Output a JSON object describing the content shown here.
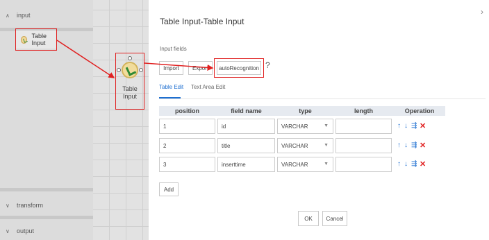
{
  "sidebar": {
    "groups": [
      {
        "label": "input",
        "chevron": "∧"
      },
      {
        "label": "transform",
        "chevron": "∨"
      },
      {
        "label": "output",
        "chevron": "∨"
      }
    ],
    "palette_item": {
      "label": "Table Input",
      "icon": "table-input-icon"
    }
  },
  "canvas": {
    "node": {
      "label_line1": "Table",
      "label_line2": "Input"
    }
  },
  "dialog": {
    "title": "Table Input-Table Input",
    "close_glyph": "›",
    "section_label": "Input fields",
    "buttons": {
      "import": "Import",
      "export": "Export",
      "auto": "autoRecognition",
      "help": "?"
    },
    "tabs": [
      {
        "label": "Table Edit",
        "active": true
      },
      {
        "label": "Text Area Edit",
        "active": false
      }
    ],
    "columns": [
      "position",
      "field name",
      "type",
      "length",
      "Operation"
    ],
    "rows": [
      {
        "position": "1",
        "field_name": "id",
        "type": "VARCHAR",
        "length": ""
      },
      {
        "position": "2",
        "field_name": "title",
        "type": "VARCHAR",
        "length": ""
      },
      {
        "position": "3",
        "field_name": "inserttime",
        "type": "VARCHAR",
        "length": ""
      }
    ],
    "ops": {
      "up": "↑",
      "down": "↓",
      "edit": "⇶",
      "delete": "✕"
    },
    "add": "Add",
    "ok": "OK",
    "cancel": "Cancel"
  },
  "colors": {
    "accent": "#1e6fd0",
    "highlight": "#e02020",
    "sidebar": "#dcdcdc"
  }
}
